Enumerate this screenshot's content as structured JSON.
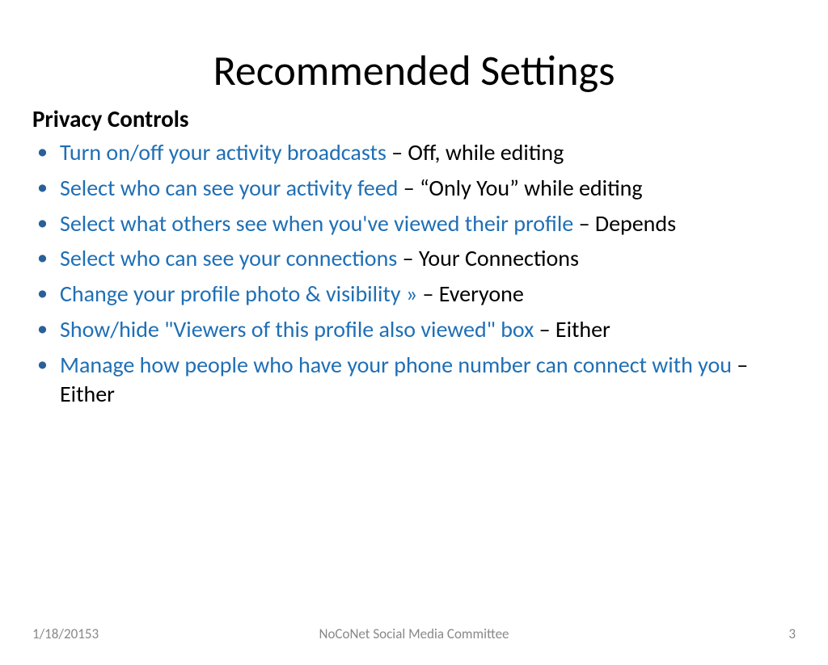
{
  "title": "Recommended Settings",
  "subtitle": "Privacy Controls",
  "items": [
    {
      "label": "Turn on/off your activity broadcasts",
      "sep": " – ",
      "rec": "Off, while editing"
    },
    {
      "label": "Select who can see your activity feed",
      "sep": " – ",
      "rec": "“Only You” while editing"
    },
    {
      "label": "Select what others see when you've viewed their profile",
      "sep": " – ",
      "rec": "Depends"
    },
    {
      "label": "Select who can see your connections",
      "sep": " – ",
      "rec": "Your Connections"
    },
    {
      "label": "Change your profile photo & visibility »",
      "sep": " – ",
      "rec": "Everyone"
    },
    {
      "label": "Show/hide \"Viewers of this profile also viewed\" box",
      "sep": " – ",
      "rec": "Either"
    },
    {
      "label": "Manage how people who have your phone number can connect with you",
      "sep": " – ",
      "rec": "Either"
    }
  ],
  "footer": {
    "date": "1/18/20153",
    "center": "NoCoNet Social Media Committee",
    "page": "3"
  }
}
